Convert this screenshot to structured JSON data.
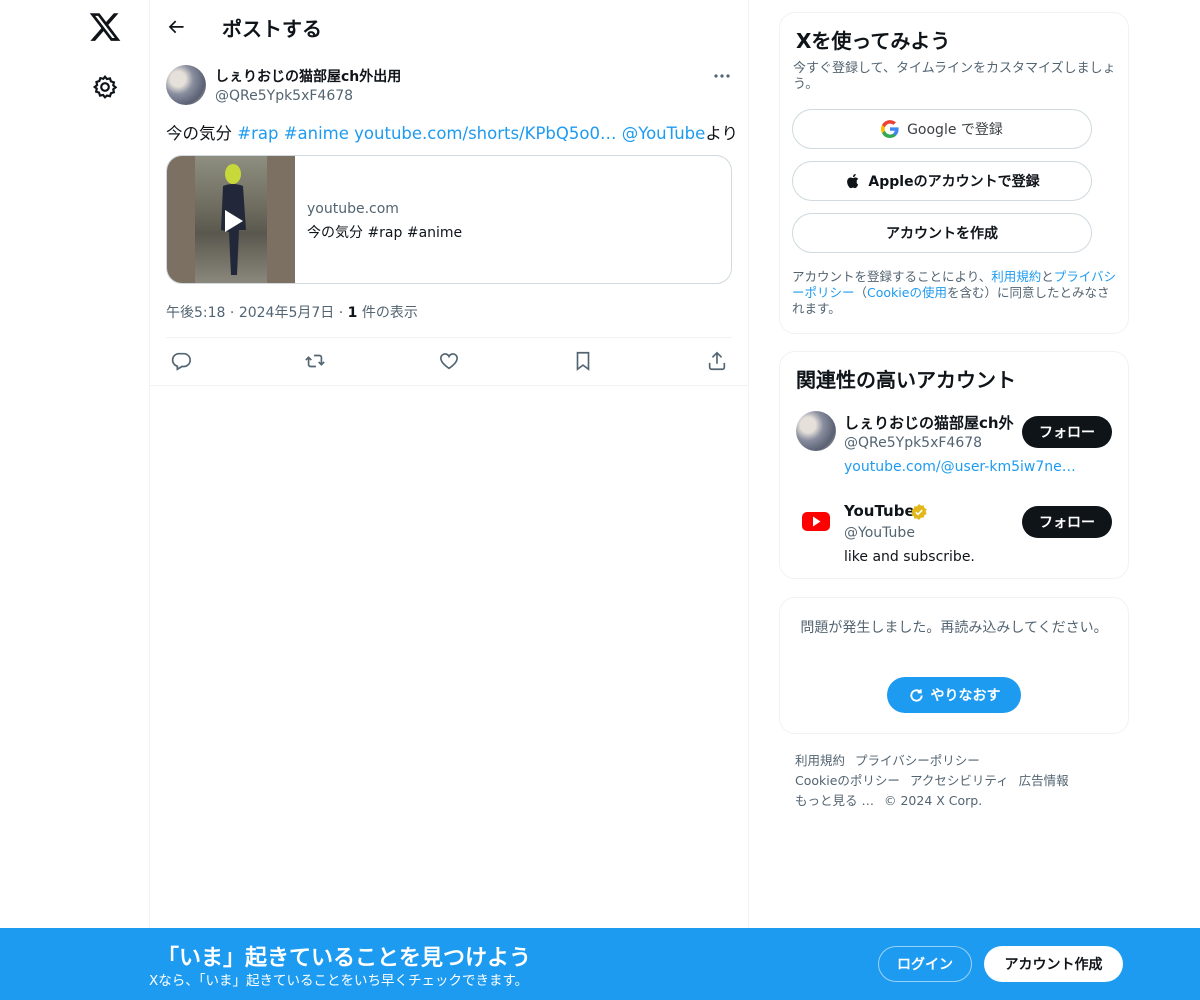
{
  "nav": {
    "logo_icon": "x-logo-icon",
    "settings_icon": "gear-icon"
  },
  "header": {
    "title": "ポストする",
    "back_icon": "arrow-left-icon"
  },
  "post": {
    "author_name": "しぇりおじの猫部屋ch外出用",
    "author_handle": "@QRe5Ypk5xF4678",
    "text_prefix": "今の気分 ",
    "hashtag_rap": "#rap",
    "hashtag_anime": "#anime",
    "url": "youtube.com/shorts/KPbQ5o0…",
    "mention": "@YouTube",
    "text_suffix": "より",
    "card": {
      "domain": "youtube.com",
      "title": "今の気分 #rap #anime"
    },
    "time": "午後5:18",
    "date": "2024年5月7日",
    "views_count": "1",
    "views_label": " 件の表示",
    "actions": [
      "reply-icon",
      "repost-icon",
      "like-icon",
      "bookmark-icon",
      "share-icon"
    ]
  },
  "signup": {
    "title": "Xを使ってみよう",
    "description": "今すぐ登録して、タイムラインをカスタマイズしましょう。",
    "google_label": "Google で登録",
    "apple_label": "Appleのアカウントで登録",
    "create_label": "アカウントを作成",
    "terms_1": "アカウントを登録することにより、",
    "terms_link1": "利用規約",
    "terms_2": "と",
    "terms_link2": "プライバシーポリシー",
    "terms_3": "（",
    "terms_link3": "Cookieの使用",
    "terms_4": "を含む）に同意したとみなされます。"
  },
  "related": {
    "title": "関連性の高いアカウント",
    "accounts": [
      {
        "name": "しぇりおじの猫部屋ch外",
        "handle": "@QRe5Ypk5xF4678",
        "bio": "youtube.com/@user-km5iw7ne…",
        "follow_label": "フォロー"
      },
      {
        "name": "YouTube",
        "handle": "@YouTube",
        "bio": "like and subscribe.",
        "follow_label": "フォロー"
      }
    ]
  },
  "error": {
    "message": "問題が発生しました。再読み込みしてください。",
    "retry_label": "やりなおす"
  },
  "footer": {
    "links": [
      "利用規約",
      "プライバシーポリシー",
      "Cookieのポリシー",
      "アクセシビリティ",
      "広告情報",
      "もっと見る …"
    ],
    "copyright": "© 2024 X Corp."
  },
  "bottom_bar": {
    "title": "「いま」起きていることを見つけよう",
    "subtitle": "Xなら、「いま」起きていることをいち早くチェックできます。",
    "login_label": "ログイン",
    "signup_label": "アカウント作成"
  },
  "colors": {
    "accent": "#1d9bf0",
    "text": "#0f1419",
    "muted": "#536471",
    "border": "#eff3f4"
  }
}
